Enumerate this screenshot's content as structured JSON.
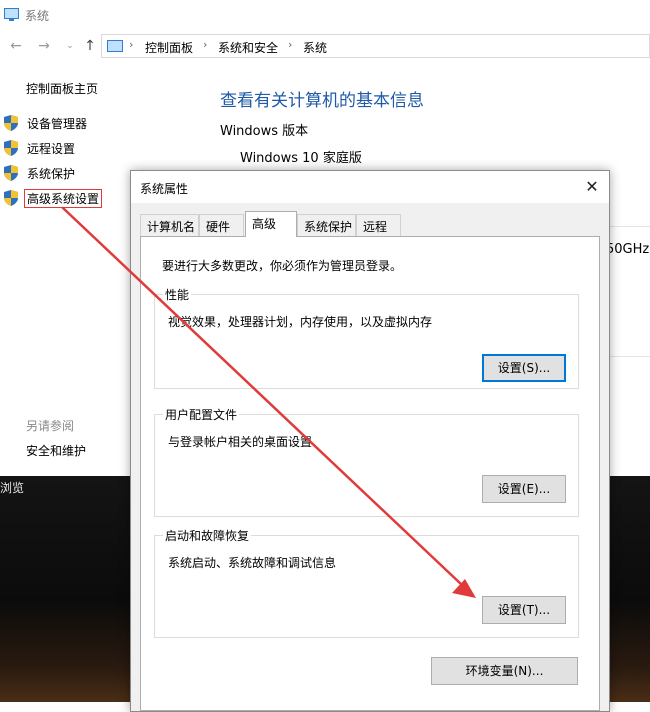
{
  "window": {
    "title": "系统",
    "breadcrumb": [
      "控制面板",
      "系统和安全",
      "系统"
    ]
  },
  "left_nav": {
    "home": "控制面板主页",
    "items": [
      {
        "label": "设备管理器",
        "icon": "shield-icon"
      },
      {
        "label": "远程设置",
        "icon": "shield-icon"
      },
      {
        "label": "系统保护",
        "icon": "shield-icon"
      },
      {
        "label": "高级系统设置",
        "icon": "shield-icon",
        "highlighted": true
      }
    ],
    "see_also": "另请参阅",
    "security_link": "安全和维护"
  },
  "main": {
    "heading": "查看有关计算机的基本信息",
    "windows_section": "Windows 版本",
    "edition": "Windows 10 家庭版",
    "cpu_fragment": "50GHz"
  },
  "background_text": "浏览",
  "dialog": {
    "title": "系统属性",
    "tabs": [
      "计算机名",
      "硬件",
      "高级",
      "系统保护",
      "远程"
    ],
    "active_tab": "高级",
    "admin_note": "要进行大多数更改，你必须作为管理员登录。",
    "performance": {
      "title": "性能",
      "desc": "视觉效果，处理器计划，内存使用，以及虚拟内存",
      "button": "设置(S)..."
    },
    "user_profiles": {
      "title": "用户配置文件",
      "desc": "与登录帐户相关的桌面设置",
      "button": "设置(E)..."
    },
    "startup_recovery": {
      "title": "启动和故障恢复",
      "desc": "系统启动、系统故障和调试信息",
      "button": "设置(T)..."
    },
    "env_button": "环境变量(N)..."
  },
  "colors": {
    "link_blue": "#1e5aa8",
    "annotation_red": "#e03a3a",
    "focus_blue": "#0078d7"
  }
}
